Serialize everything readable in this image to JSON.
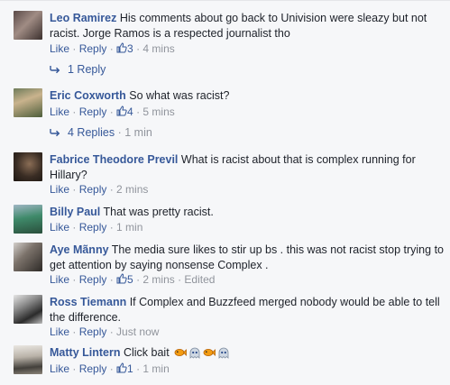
{
  "action_labels": {
    "like": "Like",
    "reply": "Reply",
    "separator": " · "
  },
  "comments": [
    {
      "author": "Leo Ramirez",
      "text": "His comments about go back to Univision were sleazy but not racist. Jorge Ramos is a respected journalist tho",
      "likes": "3",
      "time": "4 mins",
      "replies": {
        "count_label": "1 Reply",
        "time": ""
      }
    },
    {
      "author": "Eric Coxworth",
      "text": "So what was racist?",
      "likes": "4",
      "time": "5 mins",
      "replies": {
        "count_label": "4 Replies",
        "time": "1 min"
      }
    },
    {
      "author": "Fabrice Theodore Previl",
      "text": "What is racist about that is complex running for Hillary?",
      "likes": "",
      "time": "2 mins"
    },
    {
      "author": "Billy Paul",
      "text": "That was pretty racist.",
      "likes": "",
      "time": "1 min"
    },
    {
      "author": "Aye Mãnny",
      "text": "The media sure likes to stir up bs . this was not racist stop trying to get attention by saying nonsense Complex .",
      "likes": "5",
      "time": "2 mins",
      "edited": "Edited"
    },
    {
      "author": "Ross Tiemann",
      "text": "If Complex and Buzzfeed merged nobody would be able to tell the difference.",
      "likes": "",
      "time": "Just now"
    },
    {
      "author": "Matty Lintern",
      "text": "Click bait",
      "likes": "1",
      "time": "1 min",
      "emoticons": [
        "fish-icon",
        "pacman-ghost-icon",
        "fish-icon",
        "pacman-ghost-icon"
      ]
    }
  ],
  "colors": {
    "link": "#365899",
    "muted": "#90949c",
    "text": "#1d2129",
    "background": "#f6f7f9"
  }
}
